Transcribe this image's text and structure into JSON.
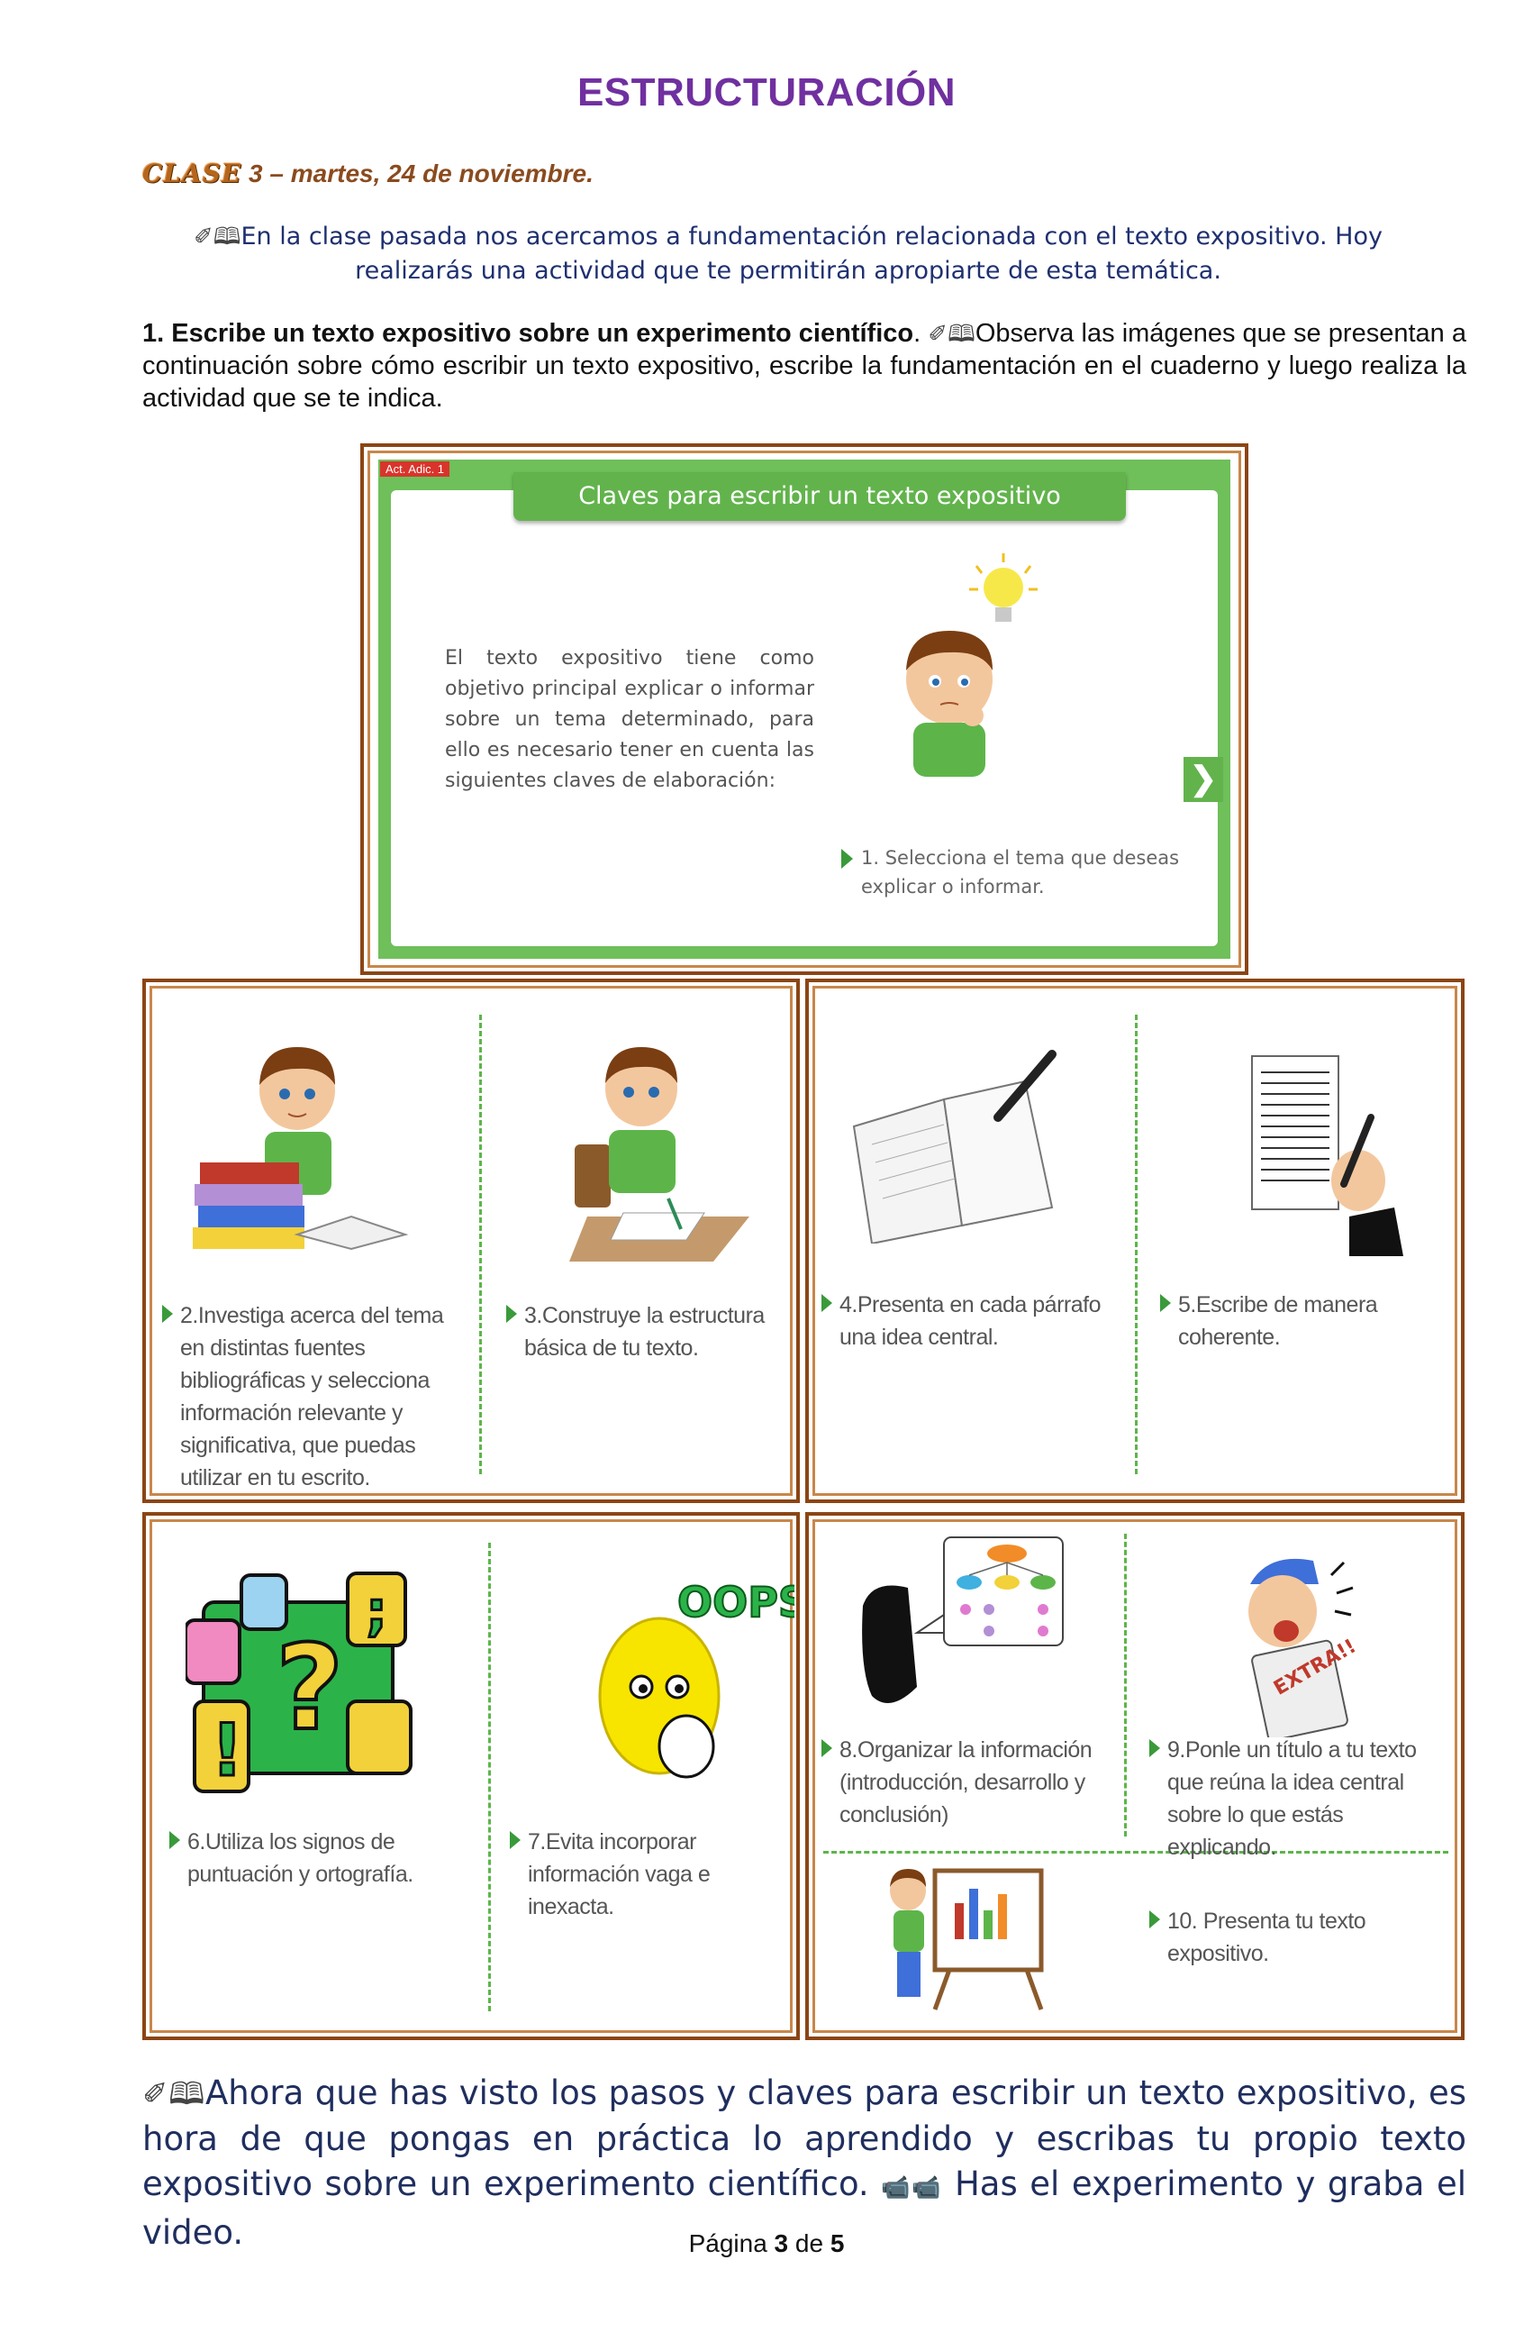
{
  "header": {
    "title": "ESTRUCTURACIÓN"
  },
  "clase": {
    "label": "CLASE",
    "detail": "3 – martes, 24 de noviembre."
  },
  "intro": {
    "icons": "✐🕮",
    "text": "En la clase pasada nos acercamos a fundamentación relacionada con el texto expositivo. Hoy realizarás una actividad que te permitirán apropiarte de esta temática."
  },
  "activity": {
    "heading": "1. Escribe un texto expositivo sobre un experimento científico",
    "period": ".",
    "icons": "✐🕮",
    "text": "Observa las imágenes que se presentan a continuación sobre cómo escribir un texto expositivo, escribe la fundamentación en el cuaderno y luego realiza la actividad que se te indica."
  },
  "slide": {
    "tab": "Act. Adic. 1",
    "header": "Claves para escribir un texto expositivo",
    "body": "El texto expositivo tiene como objetivo principal explicar o informar sobre un tema determinado, para ello es necesario tener en cuenta las siguientes claves de elaboración:",
    "step1": "1. Selecciona el tema que deseas explicar o informar.",
    "next": "❯"
  },
  "steps": {
    "s2": "2.Investiga acerca del tema en distintas fuentes bibliográficas y selecciona información relevante y significativa, que puedas utilizar en tu escrito.",
    "s3": "3.Construye la estructura básica de tu texto.",
    "s4": "4.Presenta en cada párrafo una idea central.",
    "s5": "5.Escribe de manera coherente.",
    "s6": "6.Utiliza los signos de puntuación y ortografía.",
    "s7": "7.Evita incorporar información vaga e inexacta.",
    "s8": "8.Organizar la información (introducción, desarrollo y conclusión)",
    "s9": "9.Ponle un título a tu texto que reúna la idea central sobre lo que estás explicando.",
    "s10": "10. Presenta tu texto expositivo."
  },
  "art": {
    "oops": "OOPS",
    "extra": "EXTRA!!"
  },
  "closing": {
    "icons": "✐🕮",
    "text": "Ahora que has visto los pasos y claves para escribir un texto expositivo, es hora de que pongas en práctica lo aprendido y escribas tu propio texto expositivo sobre un experimento científico.",
    "icons2": "📹📹",
    "text2": "Has el experimento y graba el video."
  },
  "footer": {
    "page_word": "Página",
    "page": "3",
    "of_word": "de",
    "total": "5"
  }
}
